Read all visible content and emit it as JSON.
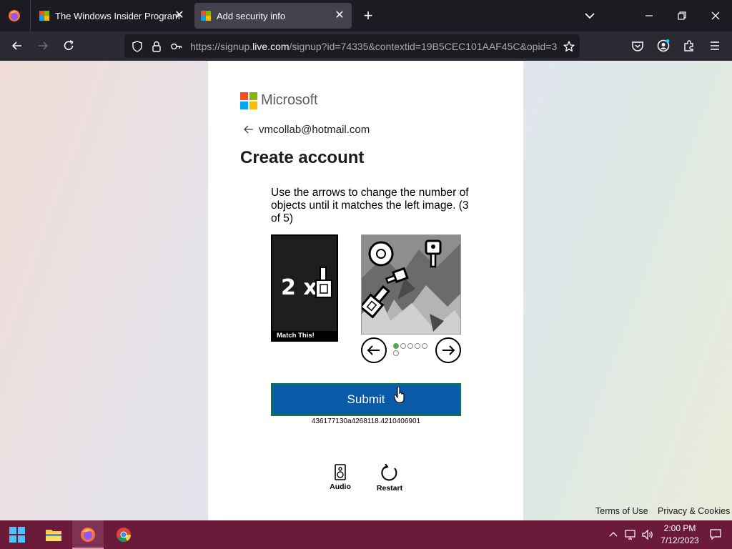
{
  "browser": {
    "tabs": [
      {
        "title": "The Windows Insider Program",
        "active": false
      },
      {
        "title": "Add security info",
        "active": true
      }
    ],
    "url": {
      "prefix": "https://signup.",
      "domain": "live.com",
      "rest": "/signup?id=74335&contextid=19B5CEC101AAF45C&opid=3"
    }
  },
  "page": {
    "brand": "Microsoft",
    "email": "vmcollab@hotmail.com",
    "heading": "Create account",
    "instructions": "Use the arrows to change the number of objects until it matches the left image. (3 of 5)",
    "target_image": {
      "multiplier": "2 x",
      "caption": "Match This!"
    },
    "pager": {
      "count": 6,
      "active_index": 0
    },
    "submit_label": "Submit",
    "session_id": "436177130a4268118.4210406901",
    "tools": [
      {
        "label": "Audio",
        "icon": "audio-icon"
      },
      {
        "label": "Restart",
        "icon": "restart-icon"
      }
    ],
    "footer": {
      "terms": "Terms of Use",
      "privacy": "Privacy & Cookies"
    }
  },
  "taskbar": {
    "apps": [
      "start-icon",
      "file-explorer-icon",
      "firefox-icon",
      "chrome-icon"
    ],
    "active_app": "firefox-icon",
    "time": "2:00 PM",
    "date": "7/12/2023"
  },
  "colors": {
    "ms_red": "#f25022",
    "ms_green": "#7fba00",
    "ms_blue": "#00a4ef",
    "ms_yellow": "#ffb900",
    "submit_bg": "#0a5ba7",
    "taskbar_bg": "#6b1a3a"
  }
}
